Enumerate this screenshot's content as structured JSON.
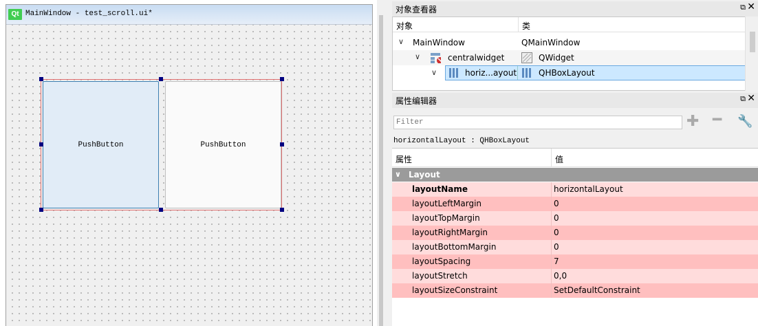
{
  "form": {
    "title": "MainWindow - test_scroll.ui*",
    "logo": "Qt",
    "buttons": [
      "PushButton",
      "PushButton"
    ]
  },
  "object_inspector": {
    "title": "对象查看器",
    "float_icon": "float-icon",
    "close_icon": "close-icon",
    "columns": [
      "对象",
      "类"
    ],
    "rows": [
      {
        "object": "MainWindow",
        "class": "QMainWindow",
        "expanded": true
      },
      {
        "object": "centralwidget",
        "class": "QWidget",
        "expanded": true
      },
      {
        "object": "horiz...ayout",
        "class": "QHBoxLayout",
        "expanded": true,
        "selected": true
      }
    ]
  },
  "property_editor": {
    "title": "属性编辑器",
    "filter_placeholder": "Filter",
    "object_label": "horizontalLayout : QHBoxLayout",
    "columns": [
      "属性",
      "值"
    ],
    "group": "Layout",
    "properties": [
      {
        "name": "layoutName",
        "value": "horizontalLayout",
        "bold": true
      },
      {
        "name": "layoutLeftMargin",
        "value": "0"
      },
      {
        "name": "layoutTopMargin",
        "value": "0"
      },
      {
        "name": "layoutRightMargin",
        "value": "0"
      },
      {
        "name": "layoutBottomMargin",
        "value": "0"
      },
      {
        "name": "layoutSpacing",
        "value": "7"
      },
      {
        "name": "layoutStretch",
        "value": "0,0"
      },
      {
        "name": "layoutSizeConstraint",
        "value": "SetDefaultConstraint"
      }
    ]
  },
  "colors": {
    "row_light": "#ffdcdc",
    "row_dark": "#ffbfbf",
    "selection": "#cce8ff",
    "group_header": "#9b9b9b"
  }
}
